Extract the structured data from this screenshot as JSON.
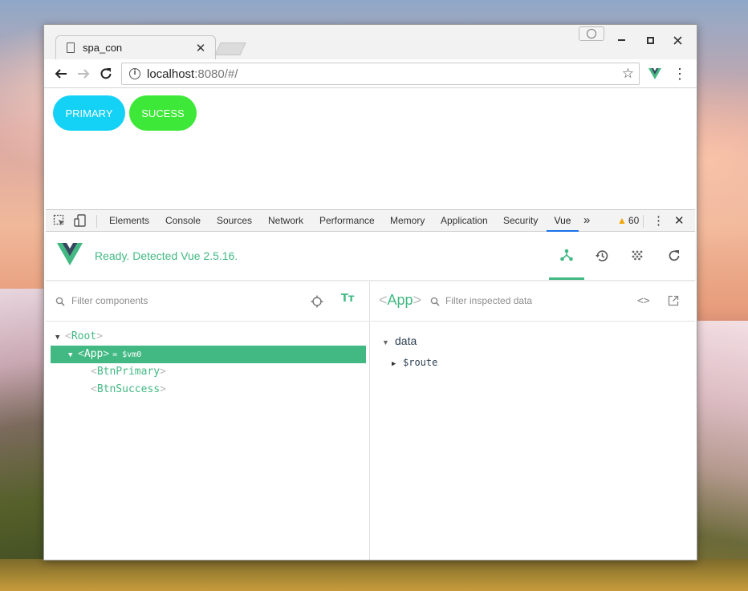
{
  "browser": {
    "tab_title": "spa_con",
    "tab_close": "✕",
    "url_host": "localhost",
    "url_rest": ":8080/#/"
  },
  "page": {
    "primary_button": "PRIMARY",
    "success_button": "SUCESS"
  },
  "devtools": {
    "tabs": [
      "Elements",
      "Console",
      "Sources",
      "Network",
      "Performance",
      "Memory",
      "Application",
      "Security",
      "Vue"
    ],
    "active_tab": "Vue",
    "more": "»",
    "warning_count": "60",
    "menu": "⋮",
    "close": "✕"
  },
  "vue": {
    "status": "Ready. Detected Vue 2.5.16.",
    "filter_components_placeholder": "Filter components",
    "filter_data_placeholder": "Filter inspected data",
    "inspected_component": "App",
    "tree": {
      "root": "Root",
      "app": "App",
      "app_vm": "= $vm0",
      "child1": "BtnPrimary",
      "child2": "BtnSuccess"
    },
    "data": {
      "section": "data",
      "route": "$route"
    }
  },
  "colors": {
    "vue_green": "#42b983",
    "primary_button": "#14d1f6",
    "success_button": "#3ee838"
  }
}
